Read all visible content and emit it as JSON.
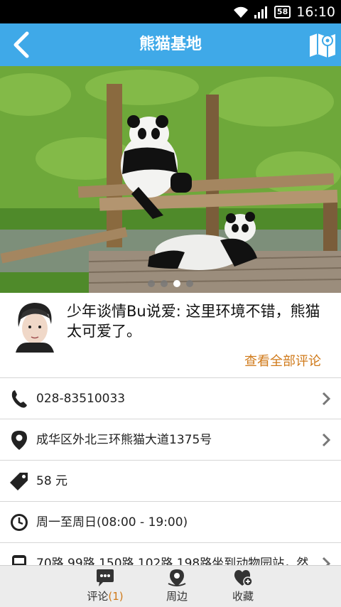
{
  "status": {
    "battery": "58",
    "time": "16:10"
  },
  "nav": {
    "title": "熊猫基地"
  },
  "carousel": {
    "pages": 4,
    "active_index": 2
  },
  "review": {
    "text": "少年谈情Bu说爱: 这里环境不错，熊猫太可爱了。",
    "see_all": "查看全部评论"
  },
  "info": [
    {
      "icon": "phone-icon",
      "text": "028-83510033",
      "chevron": true
    },
    {
      "icon": "location-pin-icon",
      "text": "成华区外北三环熊猫大道1375号",
      "chevron": true
    },
    {
      "icon": "price-tag-icon",
      "text": "58 元",
      "chevron": false
    },
    {
      "icon": "clock-icon",
      "text": "周一至周日(08:00 - 19:00)",
      "chevron": false
    },
    {
      "icon": "bus-icon",
      "text": "70路,99路,150路,102路,198路坐到动物园站，然",
      "chevron": true
    }
  ],
  "tabs": [
    {
      "icon": "comment-icon",
      "label": "评论",
      "count": "(1)"
    },
    {
      "icon": "nearby-icon",
      "label": "周边"
    },
    {
      "icon": "favorite-add-icon",
      "label": "收藏"
    }
  ],
  "colors": {
    "nav": "#3fa9e8",
    "accent": "#d07a1a"
  }
}
